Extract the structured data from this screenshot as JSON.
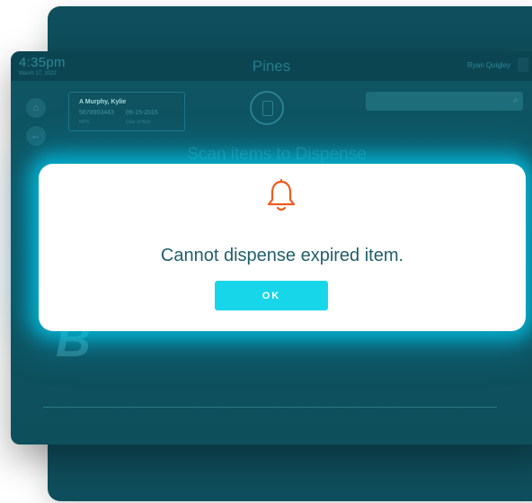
{
  "header": {
    "time": "4:35pm",
    "date": "March 17, 2022",
    "app_title": "Pines",
    "user_name": "Ryan Quigley"
  },
  "patient": {
    "name": "A Murphy, Kylie",
    "mrn": "5678903443",
    "dob": "09-15-2015",
    "mrn_label": "MRN",
    "dob_label": "Date of Birth"
  },
  "main": {
    "scan_title": "Scan items to Dispense",
    "logo_glyph": "B"
  },
  "modal": {
    "message": "Cannot dispense expired item.",
    "ok_label": "OK"
  },
  "icons": {
    "home": "⌂",
    "back": "←",
    "search": "⌕"
  },
  "colors": {
    "accent": "#18d6ea",
    "alert": "#f05a1e",
    "background": "#0e5563"
  }
}
